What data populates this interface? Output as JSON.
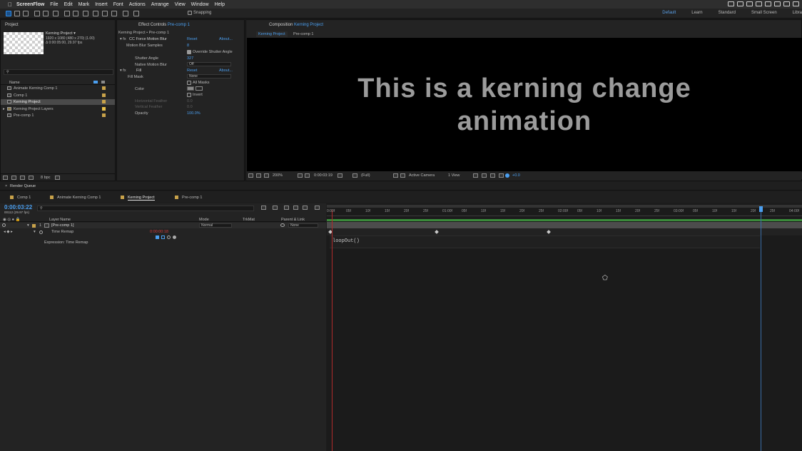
{
  "menubar": {
    "app_name": "ScreenFlow",
    "items": [
      "File",
      "Edit",
      "Mark",
      "Insert",
      "Font",
      "Actions",
      "Arrange",
      "View",
      "Window",
      "Help"
    ]
  },
  "toolbar": {
    "snapping_label": "Snapping",
    "workspaces": [
      "Default",
      "Learn",
      "Standard",
      "Small Screen",
      "Libra"
    ],
    "active_workspace": "Default"
  },
  "project_panel": {
    "tab_label": "Project",
    "item_title": "Kerning Project ▾",
    "item_info1": "1920 x 1080  (480 x 270) (1.00)",
    "item_info2": "Δ 0:00:05:00, 29.97 fps",
    "search_placeholder": "",
    "col_name": "Name",
    "items": [
      {
        "label": "Animate Kerning Comp 1",
        "type": "comp",
        "selected": false,
        "tag": "#c8a24a"
      },
      {
        "label": "Comp 1",
        "type": "comp",
        "selected": false,
        "tag": "#c8a24a"
      },
      {
        "label": "Kerning Project",
        "type": "comp",
        "selected": true,
        "tag": "#c8a24a"
      },
      {
        "label": "Kerning Project Layers",
        "type": "folder",
        "selected": false,
        "tag": "#e8c04a"
      },
      {
        "label": "Pre-comp 1",
        "type": "comp",
        "selected": false,
        "tag": "#c8a24a"
      }
    ],
    "bpc": "8 bpc"
  },
  "effect_controls": {
    "tab_prefix": "Effect Controls",
    "tab_layer": "Pre-comp 1",
    "breadcrumb": "Kerning Project • Pre-comp 1",
    "effects": [
      {
        "name": "CC Force Motion Blur",
        "reset": "Reset",
        "about": "About..."
      },
      {
        "name": "Fill",
        "reset": "Reset",
        "about": "About..."
      }
    ],
    "motion_blur_samples_label": "Motion Blur Samples",
    "motion_blur_samples_value": "8",
    "override_label": "Override Shutter Angle",
    "shutter_angle_label": "Shutter Angle",
    "shutter_angle_value": "327",
    "native_blur_label": "Native Motion Blur",
    "native_blur_value": "Off",
    "fill_mask_label": "Fill Mask",
    "fill_mask_value": "None",
    "all_masks_label": "All Masks",
    "color_label": "Color",
    "invert_label": "Invert",
    "hfeather_label": "Horizontal Feather",
    "hfeather_value": "0.0",
    "vfeather_label": "Vertical Feather",
    "vfeather_value": "0.0",
    "opacity_label": "Opacity",
    "opacity_value": "100.0%"
  },
  "composition": {
    "tab_prefix": "Composition",
    "tab_name": "Kerning Project",
    "crumbs": [
      "Kerning Project",
      "Pre-comp 1"
    ],
    "text_line1": "This is a kerning change",
    "text_line2": "animation",
    "zoom": "200%",
    "timecode": "0:00:03:19",
    "resolution": "(Full)",
    "camera": "Active Camera",
    "views": "1 View",
    "exposure": "+0.0"
  },
  "render_queue": {
    "label": "Render Queue"
  },
  "timeline": {
    "tabs": [
      {
        "label": "Comp 1",
        "active": false
      },
      {
        "label": "Animate Kerning Comp 1",
        "active": false
      },
      {
        "label": "Kerning Project",
        "active": true
      },
      {
        "label": "Pre-comp 1",
        "active": false
      }
    ],
    "current_time": "0:00:03:22",
    "frame_info": "00112 (29.97 fps)",
    "col_layer_name": "Layer Name",
    "col_mode": "Mode",
    "col_trkmat": "TrkMat",
    "col_parent": "Parent & Link",
    "layer_number": "1",
    "layer_name": "[Pre-comp 1]",
    "layer_mode": "Normal",
    "layer_parent": "None",
    "prop_name": "Time Remap",
    "prop_value": "0:00:00:18",
    "expression_label": "Expression: Time Remap",
    "expression_text": "loopOut()",
    "ruler_labels": [
      "0:00f",
      "05f",
      "10f",
      "15f",
      "20f",
      "25f",
      "01:00f",
      "05f",
      "10f",
      "15f",
      "20f",
      "25f",
      "02:00f",
      "05f",
      "10f",
      "15f",
      "20f",
      "25f",
      "03:00f",
      "05f",
      "10f",
      "15f",
      "20f",
      "25f",
      "04:00f"
    ]
  }
}
